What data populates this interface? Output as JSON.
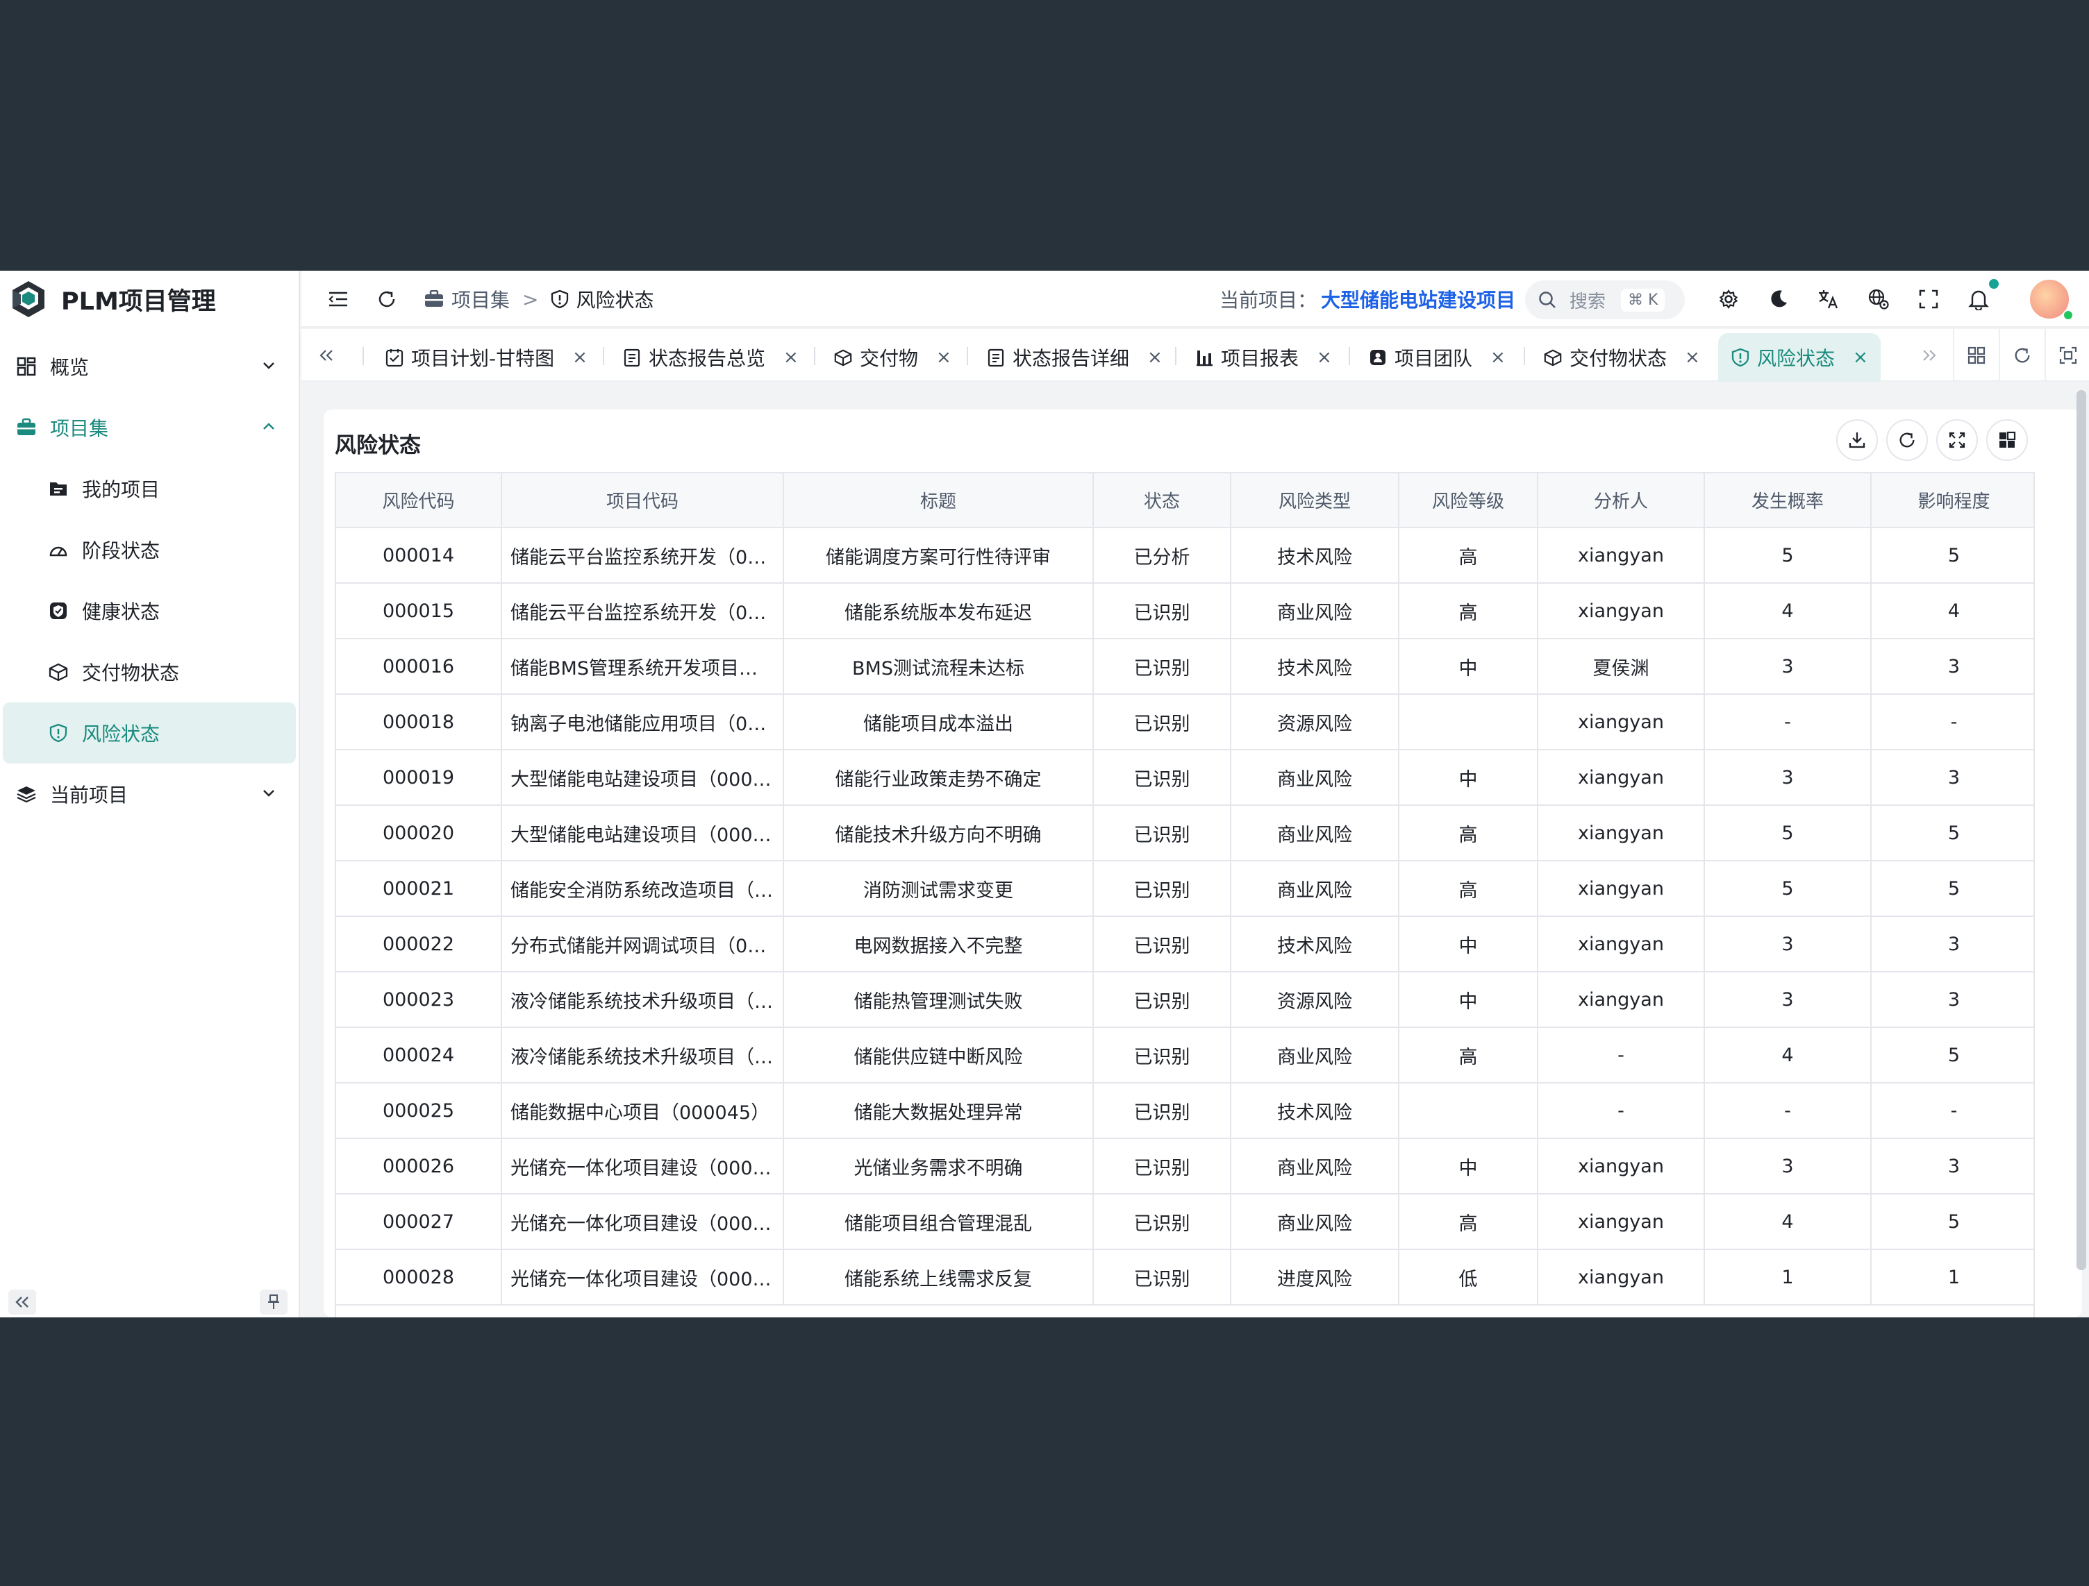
{
  "app": {
    "title": "PLM项目管理"
  },
  "sidebar": {
    "items": [
      {
        "label": "概览",
        "icon": "dashboard-icon"
      },
      {
        "label": "项目集",
        "icon": "briefcase-icon"
      },
      {
        "label": "我的项目",
        "icon": "folder-icon"
      },
      {
        "label": "阶段状态",
        "icon": "gauge-icon"
      },
      {
        "label": "健康状态",
        "icon": "shield-check-icon"
      },
      {
        "label": "交付物状态",
        "icon": "package-icon"
      },
      {
        "label": "风险状态",
        "icon": "shield-alert-icon"
      },
      {
        "label": "当前项目",
        "icon": "layers-icon"
      }
    ]
  },
  "header": {
    "breadcrumb": {
      "parent": "项目集",
      "separator": ">",
      "current": "风险状态"
    },
    "current_project_label": "当前项目：",
    "current_project_value": "大型储能电站建设项目",
    "search_placeholder": "搜索",
    "search_shortcut": "⌘ K"
  },
  "tabs": [
    {
      "label": "项目计划-甘特图",
      "icon": "calendar-check-icon"
    },
    {
      "label": "状态报告总览",
      "icon": "report-icon"
    },
    {
      "label": "交付物",
      "icon": "package-icon"
    },
    {
      "label": "状态报告详细",
      "icon": "report-icon"
    },
    {
      "label": "项目报表",
      "icon": "bar-chart-icon"
    },
    {
      "label": "项目团队",
      "icon": "team-icon"
    },
    {
      "label": "交付物状态",
      "icon": "package-icon"
    },
    {
      "label": "风险状态",
      "icon": "shield-alert-icon",
      "active": true
    }
  ],
  "tab_close": "×",
  "content": {
    "title": "风险状态",
    "table": {
      "columns": [
        "风险代码",
        "项目代码",
        "标题",
        "状态",
        "风险类型",
        "风险等级",
        "分析人",
        "发生概率",
        "影响程度"
      ],
      "rows": [
        [
          "000014",
          "储能云平台监控系统开发（00...",
          "储能调度方案可行性待评审",
          "已分析",
          "技术风险",
          "高",
          "xiangyan",
          "5",
          "5"
        ],
        [
          "000015",
          "储能云平台监控系统开发（00...",
          "储能系统版本发布延迟",
          "已识别",
          "商业风险",
          "高",
          "xiangyan",
          "4",
          "4"
        ],
        [
          "000016",
          "储能BMS管理系统开发项目（...",
          "BMS测试流程未达标",
          "已识别",
          "技术风险",
          "中",
          "夏侯渊",
          "3",
          "3"
        ],
        [
          "000018",
          "钠离子电池储能应用项目（00...",
          "储能项目成本溢出",
          "已识别",
          "资源风险",
          "",
          "xiangyan",
          "-",
          "-"
        ],
        [
          "000019",
          "大型储能电站建设项目（0000...",
          "储能行业政策走势不确定",
          "已识别",
          "商业风险",
          "中",
          "xiangyan",
          "3",
          "3"
        ],
        [
          "000020",
          "大型储能电站建设项目（0000...",
          "储能技术升级方向不明确",
          "已识别",
          "商业风险",
          "高",
          "xiangyan",
          "5",
          "5"
        ],
        [
          "000021",
          "储能安全消防系统改造项目（0...",
          "消防测试需求变更",
          "已识别",
          "商业风险",
          "高",
          "xiangyan",
          "5",
          "5"
        ],
        [
          "000022",
          "分布式储能并网调试项目（00...",
          "电网数据接入不完整",
          "已识别",
          "技术风险",
          "中",
          "xiangyan",
          "3",
          "3"
        ],
        [
          "000023",
          "液冷储能系统技术升级项目（0...",
          "储能热管理测试失败",
          "已识别",
          "资源风险",
          "中",
          "xiangyan",
          "3",
          "3"
        ],
        [
          "000024",
          "液冷储能系统技术升级项目（0...",
          "储能供应链中断风险",
          "已识别",
          "商业风险",
          "高",
          "-",
          "4",
          "5"
        ],
        [
          "000025",
          "储能数据中心项目（000045）",
          "储能大数据处理异常",
          "已识别",
          "技术风险",
          "",
          "-",
          "-",
          "-"
        ],
        [
          "000026",
          "光储充一体化项目建设（0000...",
          "光储业务需求不明确",
          "已识别",
          "商业风险",
          "中",
          "xiangyan",
          "3",
          "3"
        ],
        [
          "000027",
          "光储充一体化项目建设（0000...",
          "储能项目组合管理混乱",
          "已识别",
          "商业风险",
          "高",
          "xiangyan",
          "4",
          "5"
        ],
        [
          "000028",
          "光储充一体化项目建设（0000...",
          "储能系统上线需求反复",
          "已识别",
          "进度风险",
          "低",
          "xiangyan",
          "1",
          "1"
        ]
      ]
    }
  },
  "colors": {
    "accent": "#1a8a7e",
    "accent_bg": "#e3f2f0",
    "link": "#1d62e6",
    "outer_bg": "#27323a"
  }
}
